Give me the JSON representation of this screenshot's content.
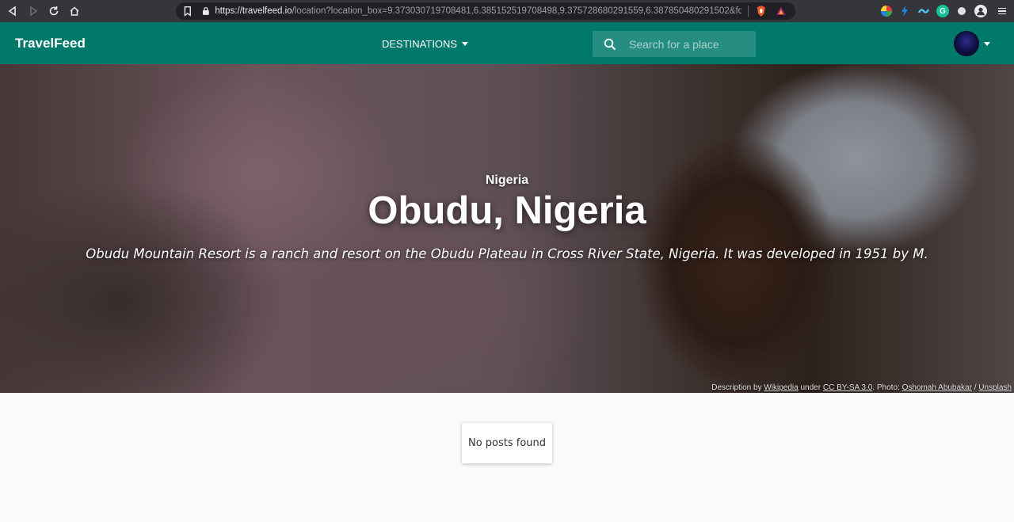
{
  "browser": {
    "url_main": "https://travelfeed.io",
    "url_rest": "/location?location_box=9.373030719708481,6.385152519708498,9.375728680291559,6.387850480291502&forma..."
  },
  "nav": {
    "brand": "TravelFeed",
    "destinations": "DESTINATIONS",
    "search_placeholder": "Search for a place"
  },
  "hero": {
    "country": "Nigeria",
    "title": "Obudu, Nigeria",
    "description": "Obudu Mountain Resort is a ranch and resort on the Obudu Plateau in Cross River State, Nigeria. It was developed in 1951 by M.",
    "credit": {
      "prefix": "Description by",
      "source": "Wikipedia",
      "under": "under",
      "license": "CC BY-SA 3.0",
      "photo_label": ". Photo:",
      "photographer": "Oshomah Abubakar",
      "slash": "/",
      "platform": "Unsplash"
    }
  },
  "content": {
    "empty_message": "No posts found"
  },
  "colors": {
    "primary": "#00796b",
    "browser_bar": "#35363a"
  }
}
